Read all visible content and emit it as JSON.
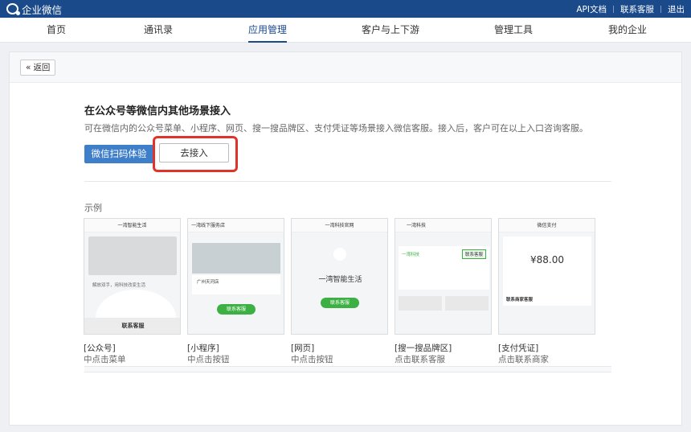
{
  "topbar": {
    "logo_text": "企业微信",
    "links": [
      "API文档",
      "联系客服",
      "退出"
    ]
  },
  "nav": {
    "items": [
      "首页",
      "通讯录",
      "应用管理",
      "客户与上下游",
      "管理工具",
      "我的企业"
    ],
    "active": "应用管理"
  },
  "back": {
    "label": "返回"
  },
  "section": {
    "title": "在公众号等微信内其他场景接入",
    "description": "可在微信内的公众号菜单、小程序、网页、搜一搜品牌区、支付凭证等场景接入微信客服。接入后，客户可在以上入口咨询客服。",
    "primary_button": "微信扫码体验",
    "connect_button": "去接入"
  },
  "examples": {
    "label": "示例",
    "cards": [
      {
        "caption": "[公众号]",
        "sub": "中点击菜单",
        "header": "一湾智能生活",
        "body_text": "解放双手，用科技改变生活",
        "cta": "联系客服"
      },
      {
        "caption": "[小程序]",
        "sub": "中点击按钮",
        "header": "一湾线下服务店",
        "body_text": "广州天河店",
        "cta": "联系客服"
      },
      {
        "caption": "[网页]",
        "sub": "中点击按钮",
        "header": "一湾科技官网",
        "body_text": "一湾智能生活",
        "cta": "联系客服"
      },
      {
        "caption": "[搜一搜品牌区]",
        "sub": "点击联系客服",
        "header": "一湾科技",
        "body_text": "一湾科技",
        "cta": "联系客服"
      },
      {
        "caption": "[支付凭证]",
        "sub": "点击联系商家",
        "header": "微信支付",
        "body_text": "¥88.00",
        "cta": "联系商家客服"
      }
    ]
  },
  "colors": {
    "brand": "#1b4a8a",
    "primary": "#3f7fca",
    "highlight": "#e0332c",
    "green": "#3cb043"
  }
}
